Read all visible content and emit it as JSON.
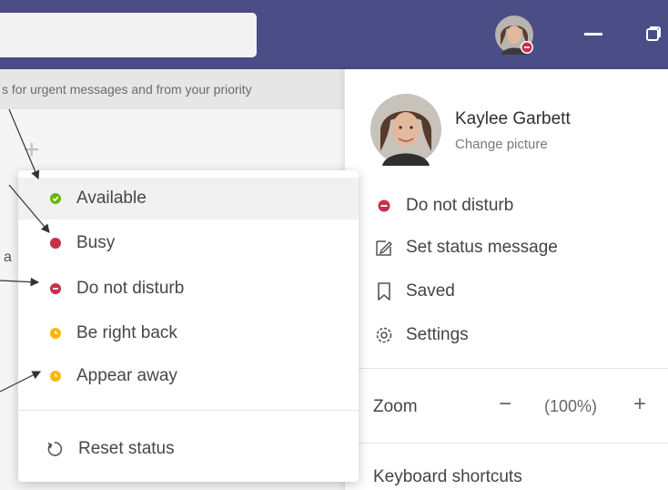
{
  "titlebar": {
    "minimize_icon": "minimize-icon",
    "maximize_icon": "maximize-icon",
    "presence_badge": "do-not-disturb"
  },
  "banner": {
    "text": "s for urgent messages and from your priority"
  },
  "left": {
    "plus_glyph": "+",
    "partial_letter": "a"
  },
  "profile": {
    "name": "Kaylee Garbett",
    "change_picture": "Change picture",
    "current_status": "Do not disturb",
    "set_status_message": "Set status message",
    "saved": "Saved",
    "settings": "Settings",
    "zoom_label": "Zoom",
    "zoom_minus": "−",
    "zoom_value": "(100%)",
    "zoom_plus": "+",
    "keyboard_shortcuts": "Keyboard shortcuts"
  },
  "status_menu": {
    "items": [
      {
        "label": "Available",
        "color": "#6bb700",
        "kind": "check"
      },
      {
        "label": "Busy",
        "color": "#c4314b",
        "kind": "dot"
      },
      {
        "label": "Do not disturb",
        "color": "#c4314b",
        "kind": "minus"
      },
      {
        "label": "Be right back",
        "color": "#f8b70e",
        "kind": "clock"
      },
      {
        "label": "Appear away",
        "color": "#f8b70e",
        "kind": "clock"
      }
    ],
    "reset": "Reset status"
  },
  "colors": {
    "titlebar": "#4a4d86",
    "available": "#6bb700",
    "busy": "#c4314b",
    "away": "#f8b70e"
  }
}
